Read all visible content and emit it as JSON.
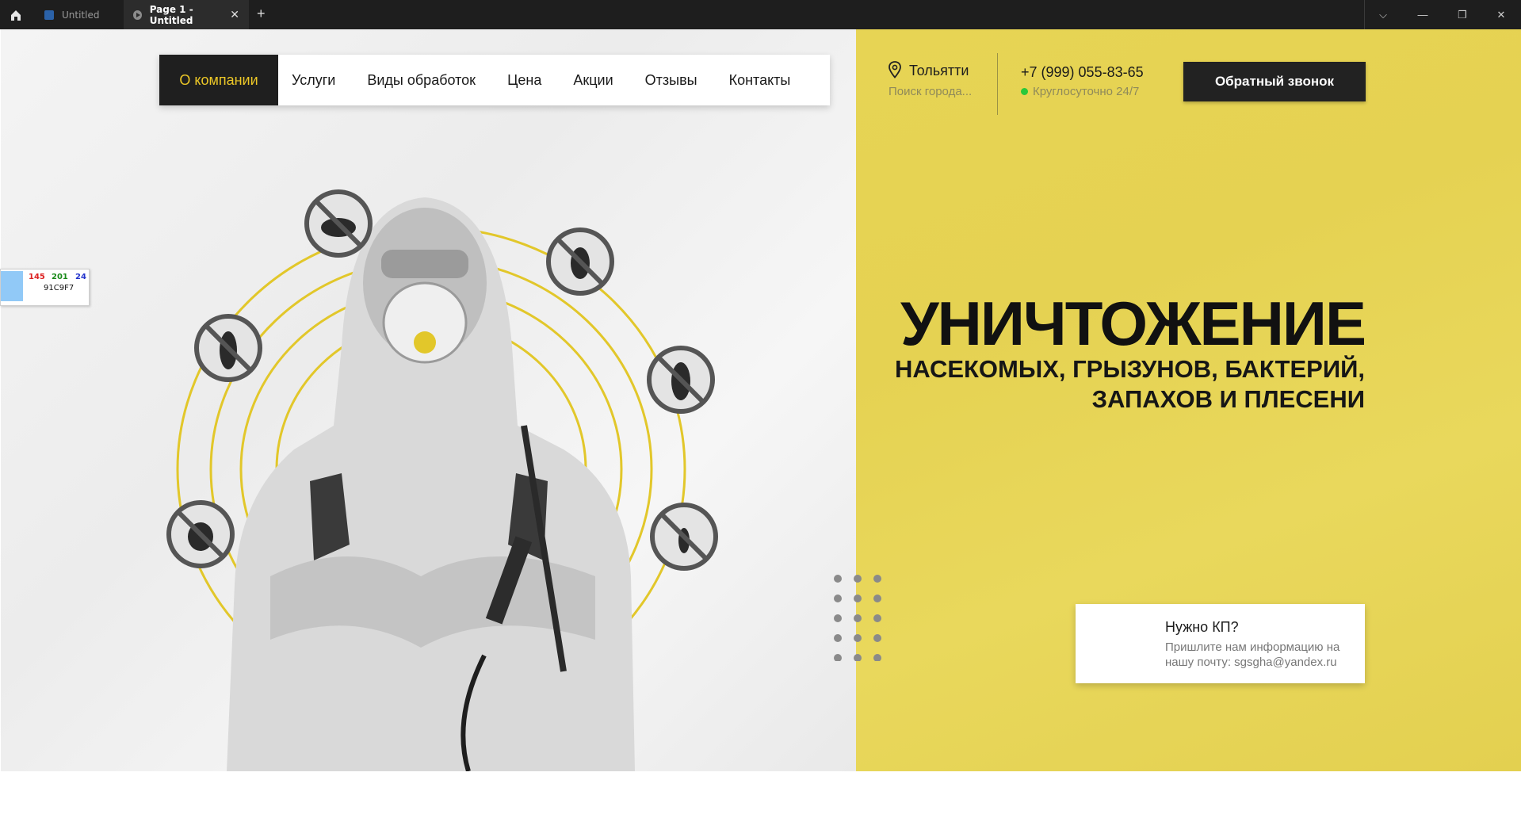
{
  "window": {
    "tabs": [
      {
        "label": "Untitled"
      },
      {
        "label": "Page 1 - Untitled"
      }
    ],
    "close_glyph": "✕",
    "add_glyph": "+",
    "controls": [
      "⌵",
      "—",
      "❐",
      "✕"
    ]
  },
  "nav": {
    "items": [
      "О компании",
      "Услуги",
      "Виды обработок",
      "Цена",
      "Акции",
      "Отзывы",
      "Контакты"
    ],
    "active_index": 0
  },
  "contact": {
    "city": "Тольятти",
    "city_search_placeholder": "Поиск города...",
    "phone": "+7 (999) 055-83-65",
    "hours": "Круглосуточно 24/7",
    "callback_button": "Обратный звонок"
  },
  "hero": {
    "title": "УНИЧТОЖЕНИЕ",
    "subtitle_line1": "НАСЕКОМЫХ, ГРЫЗУНОВ, БАКТЕРИЙ,",
    "subtitle_line2": "ЗАПАХОВ И ПЛЕСЕНИ"
  },
  "kp_card": {
    "title": "Нужно КП?",
    "text": "Пришлите нам информацию на нашу почту: sgsgha@yandex.ru"
  },
  "color_picker": {
    "r": "145",
    "g": "201",
    "b": "24",
    "hex": "91C9F7"
  },
  "colors": {
    "accent_yellow": "#e6d455",
    "nav_active_bg": "#1f1f1f",
    "nav_active_text": "#ecc727",
    "online_dot": "#29c83a"
  }
}
